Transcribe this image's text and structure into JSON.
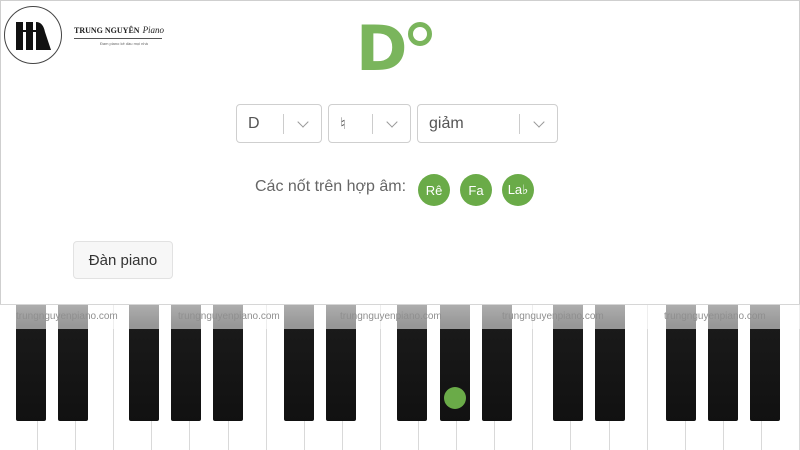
{
  "logo": {
    "brand": "TRUNG NGUYÊN",
    "brand_script": "Piano",
    "tagline": "Đam piano kê dầu mọi nhà"
  },
  "chord": {
    "root": "D",
    "symbol": "diminished-circle"
  },
  "selects": {
    "root": {
      "value": "D"
    },
    "accidental": {
      "value": "♮"
    },
    "quality": {
      "value": "giảm"
    }
  },
  "notes": {
    "label": "Các nốt trên hợp âm:",
    "items": [
      "Rê",
      "Fa",
      "La♭"
    ]
  },
  "actions": {
    "play_label": "Đàn piano"
  },
  "watermark": {
    "text": "trungnguyenpiano.com"
  },
  "colors": {
    "accent": "#7ab55c",
    "note_bg": "#6aab48"
  },
  "icons": {
    "dropdown": "chevron-down-icon",
    "logo": "piano-logo-icon"
  }
}
